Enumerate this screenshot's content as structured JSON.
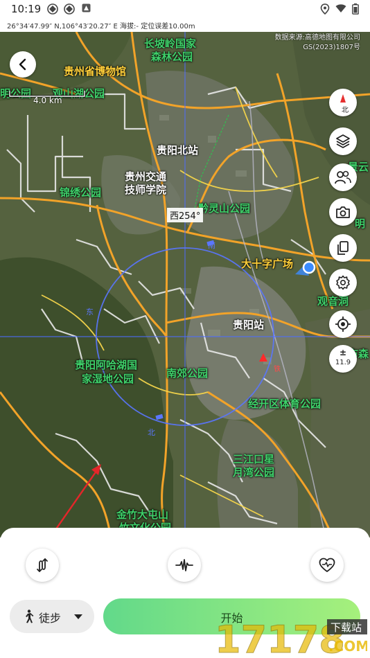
{
  "status_bar": {
    "time": "10:19",
    "gps_label": "GPS",
    "icons": [
      "app-icon",
      "app-icon",
      "notification-icon",
      "location-icon",
      "wifi-icon",
      "battery-icon"
    ]
  },
  "coords_bar": {
    "text": "26°34′47.99″ N,106°43′20.27″ E 海拔:- 定位误差10.00m"
  },
  "map": {
    "attribution_line1": "数据来源:高德地图有限公司",
    "attribution_line2": "GS(2023)1807号",
    "scale_text": "4.0 km",
    "heading_text": "西254°",
    "compass_label": "北",
    "zoom_level": "11.9",
    "zoom_symbol": "±",
    "labels": {
      "guizhou_museum": "贵州省博物馆",
      "changpoling": "长坡岭国家",
      "forest_park": "森林公园",
      "guanshan_park": "观山湖公园",
      "guanshan_partial": "明公园",
      "guiyang_north": "贵阳北站",
      "guizhou_jiaotong": "贵州交通",
      "technician_college": "技师学院",
      "jinxiu_park": "锦绣公园",
      "qianlingshan": "黔灵山公园",
      "dashizi": "大十字广场",
      "guanyindong": "观音洞",
      "guiyang_station": "贵阳站",
      "aha_lake": "贵阳阿哈湖国",
      "wetland_park": "家湿地公园",
      "nanjiao_park": "南郊公园",
      "jingkai": "经开区体育公园",
      "sanjiangkou": "三江口星",
      "yuewan_park": "月湾公园",
      "jinzhu": "金竹大屯山",
      "culture_park": "竹文化公园",
      "right_partial1": "景云",
      "right_partial2": "明",
      "right_partial3": "市森"
    }
  },
  "bottom_panel": {
    "mode_label": "徒步",
    "start_label": "开始"
  },
  "watermark": {
    "numbers": "17178",
    "site_label": "下载站",
    "domain": ".COM"
  }
}
